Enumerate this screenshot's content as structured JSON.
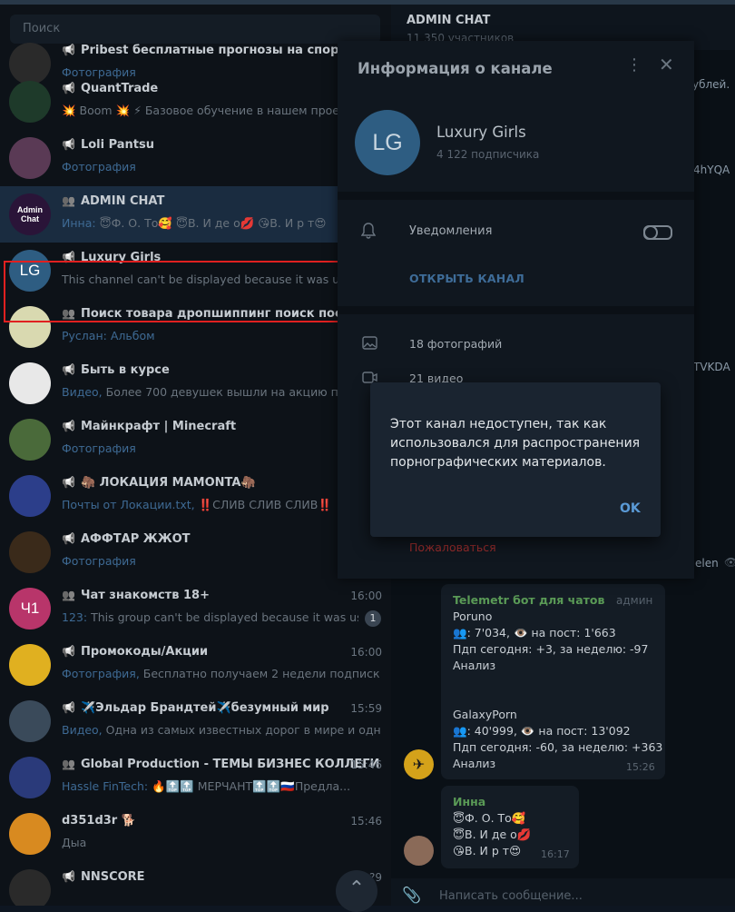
{
  "search": {
    "placeholder": "Поиск"
  },
  "chats": [
    {
      "title": "Pribest бесплатные прогнозы на спорт",
      "kind": "channel",
      "time": "",
      "preview_sender": "",
      "preview_media": "Фотография",
      "preview_text": "",
      "avatar_text": "",
      "avatar_color": "#2a2a2a"
    },
    {
      "title": "QuantTrade",
      "kind": "channel",
      "time": "",
      "preview_sender": "",
      "preview_media": "",
      "preview_text": "💥 Boom 💥 ⚡ Базовое обучение в нашем проекте",
      "avatar_text": "",
      "avatar_color": "#1e3a2a"
    },
    {
      "title": "Loli Pantsu",
      "kind": "channel",
      "time": "",
      "preview_sender": "",
      "preview_media": "Фотография",
      "preview_text": "",
      "avatar_text": "",
      "avatar_color": "#5a3a55"
    },
    {
      "title": "ADMIN CHAT",
      "kind": "group",
      "time": "",
      "preview_sender": "Инна:",
      "preview_media": "",
      "preview_text": " 😇Ф. О. То🥰 😇В. И де о💋 😘В. И р т😍",
      "avatar_text": "Admin Chat",
      "avatar_color": "#2a1438"
    },
    {
      "title": "Luxury Girls",
      "kind": "channel",
      "time": "",
      "preview_sender": "",
      "preview_media": "",
      "preview_text": "This channel can't be displayed because it was used",
      "avatar_text": "LG",
      "avatar_color": "#2e5d82"
    },
    {
      "title": "Поиск товара дропшиппинг поиск постав...",
      "kind": "group",
      "time": "",
      "preview_sender": "Руслан:",
      "preview_media": "Альбом",
      "preview_text": "",
      "avatar_text": "",
      "avatar_color": "#d9d9b0"
    },
    {
      "title": "Быть в курсе",
      "kind": "channel",
      "time": "",
      "preview_sender": "",
      "preview_media": "Видео,",
      "preview_text": " Более 700 девушек вышли на акцию протеста",
      "avatar_text": "",
      "avatar_color": "#e8e8e8"
    },
    {
      "title": "Майнкрафт | Minecraft",
      "kind": "channel",
      "time": "",
      "preview_sender": "",
      "preview_media": "Фотография",
      "preview_text": "",
      "avatar_text": "",
      "avatar_color": "#4a6a3a"
    },
    {
      "title": "🦣 ЛОКАЦИЯ MAMONTA🦣",
      "kind": "channel",
      "time": "",
      "preview_sender": "",
      "preview_media": "Почты от Локации.txt,",
      "preview_text": " ‼️СЛИВ СЛИВ СЛИВ‼️",
      "avatar_text": "",
      "avatar_color": "#2c3e8a"
    },
    {
      "title": "АФФТАР ЖЖОТ",
      "kind": "channel",
      "time": "",
      "preview_sender": "",
      "preview_media": "Фотография",
      "preview_text": "",
      "avatar_text": "",
      "avatar_color": "#3a2a1a"
    },
    {
      "title": "Чат знакомств 18+",
      "kind": "group",
      "time": "16:00",
      "preview_sender": "123:",
      "preview_media": "",
      "preview_text": " This group can't be displayed because it was used...",
      "avatar_text": "Ч1",
      "avatar_color": "#b8356a",
      "badge": "1"
    },
    {
      "title": "Промокоды/Акции",
      "kind": "channel",
      "time": "16:00",
      "preview_sender": "",
      "preview_media": "Фотография,",
      "preview_text": " Бесплатно получаем 2 недели подписки на",
      "avatar_text": "",
      "avatar_color": "#e0b020"
    },
    {
      "title": "✈️Эльдар Брандтей✈️безумный мир",
      "kind": "channel",
      "time": "15:59",
      "preview_sender": "",
      "preview_media": "Видео,",
      "preview_text": " Одна из самых известных дорог в мире и одна",
      "avatar_text": "",
      "avatar_color": "#3a4a5a"
    },
    {
      "title": "Global Production - ТЕМЫ БИЗНЕС КОЛЛЕГИ ...",
      "kind": "group",
      "time": "15:46",
      "preview_sender": "Hassle FinTech:",
      "preview_media": "",
      "preview_text": " 🔥🔝🔝 МЕРЧАНТ🔝🔝🇷🇺Предла...",
      "avatar_text": "",
      "avatar_color": "#2a3a7a"
    },
    {
      "title": "d351d3r 🐕",
      "kind": "user",
      "time": "15:46",
      "preview_sender": "",
      "preview_media": "",
      "preview_text": "Дыа",
      "avatar_text": "",
      "avatar_color": "#d88a20"
    },
    {
      "title": "NNSCORE",
      "kind": "channel",
      "time": "15:?9",
      "preview_sender": "",
      "preview_media": "",
      "preview_text": "",
      "avatar_text": "",
      "avatar_color": "#2a2a2a"
    }
  ],
  "chat": {
    "title": "ADMIN CHAT",
    "subtitle": "11 350 участников",
    "snippets": [
      "ублей.",
      "4hYQA",
      "TVKDA",
      "elen"
    ],
    "messages": [
      {
        "sender": "Telemetr бот для чатов",
        "role": "админ",
        "lines": [
          {
            "link": "Poruno",
            "text": ""
          },
          {
            "link": "",
            "text": "👥: 7'034, 👁️ на пост: 1'663"
          },
          {
            "link": "",
            "text": "Пдп сегодня: +3, за неделю: -97"
          },
          {
            "link": "Анализ",
            "text": ""
          },
          {
            "link": "",
            "text": ""
          },
          {
            "link": "GalaxyPorn",
            "text": ""
          },
          {
            "link": "",
            "text": "👥: 40'999, 👁️ на пост: 13'092"
          },
          {
            "link": "",
            "text": "Пдп сегодня: -60, за неделю: +363"
          },
          {
            "link": "Анализ",
            "text": ""
          }
        ],
        "time": "15:26"
      },
      {
        "sender": "Инна",
        "lines": [
          "😇Ф. О. То🥰",
          "😇В. И де о💋",
          "😘В. И р т😍"
        ],
        "time": "16:17"
      }
    ],
    "composer_placeholder": "Написать сообщение..."
  },
  "info": {
    "title": "Информация о канале",
    "name": "Luxury Girls",
    "avatar_text": "LG",
    "avatar_color": "#2e5d82",
    "subscribers": "4 122 подписчика",
    "notifications_label": "Уведомления",
    "notifications_on": false,
    "open_channel": "ОТКРЫТЬ КАНАЛ",
    "photos": "18 фотографий",
    "videos": "21 видео",
    "report": "Пожаловаться"
  },
  "alert": {
    "message": "Этот канал недоступен, так как использовался для распространения порнографических материалов.",
    "ok": "OK"
  },
  "colors": {
    "accent": "#5a9ad6",
    "danger": "#e02020",
    "bg": "#0e1621"
  }
}
